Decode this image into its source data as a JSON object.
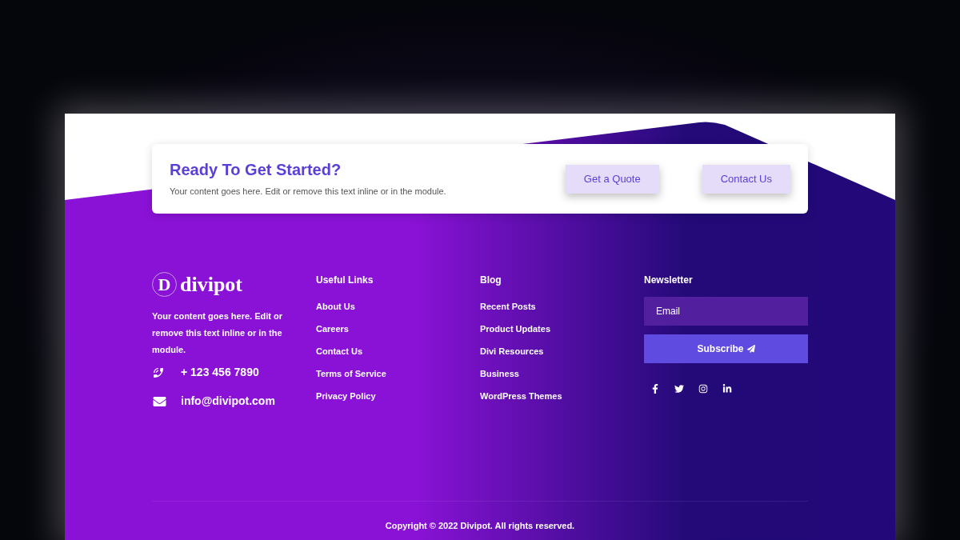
{
  "cta": {
    "title": "Ready To Get Started?",
    "text": "Your content goes here. Edit or remove this text inline or in the module.",
    "buttons": [
      "Get a Quote",
      "Contact Us"
    ]
  },
  "brand": {
    "initial": "D",
    "name": "divipot",
    "text": "Your content goes here. Edit or remove this text inline or in the module.",
    "phone": "+ 123 456 7890",
    "email": "info@divipot.com"
  },
  "columns": [
    {
      "title": "Useful Links",
      "links": [
        "About Us",
        "Careers",
        "Contact Us",
        "Terms of Service",
        "Privacy Policy"
      ]
    },
    {
      "title": "Blog",
      "links": [
        "Recent Posts",
        "Product Updates",
        "Divi Resources",
        "Business",
        "WordPress Themes"
      ]
    }
  ],
  "newsletter": {
    "title": "Newsletter",
    "placeholder": "Email",
    "button": "Subscribe",
    "social": [
      {
        "kind": "facebook"
      },
      {
        "kind": "twitter"
      },
      {
        "kind": "instagram"
      },
      {
        "kind": "linkedin"
      }
    ]
  },
  "copyright": "Copyright © 2022 Divipot. All rights reserved."
}
